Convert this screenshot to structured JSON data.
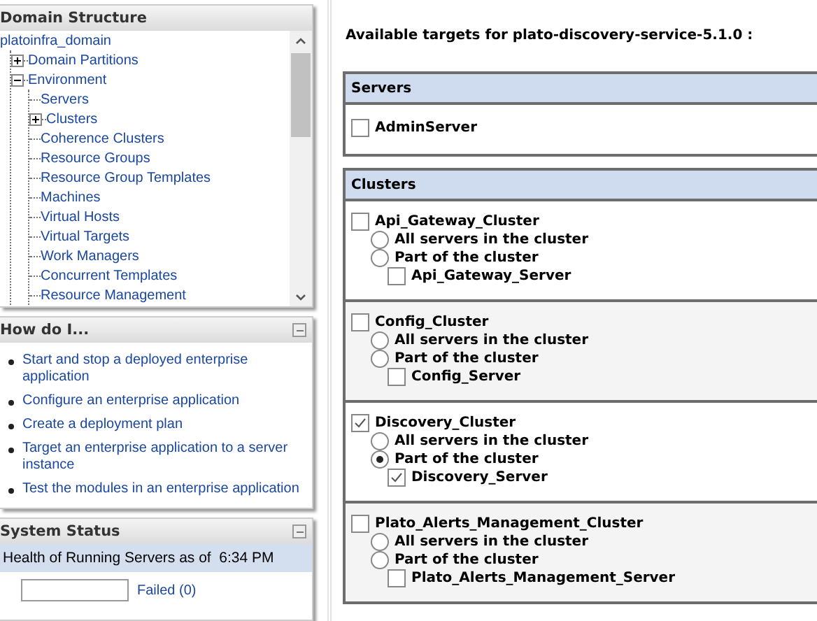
{
  "domain_structure": {
    "title": "Domain Structure",
    "tree": [
      {
        "label": "platoinfra_domain",
        "children": [
          {
            "label": "Domain Partitions",
            "expanded": false
          },
          {
            "label": "Environment",
            "expanded": true,
            "children": [
              {
                "label": "Servers"
              },
              {
                "label": "Clusters",
                "expanded": false
              },
              {
                "label": "Coherence Clusters"
              },
              {
                "label": "Resource Groups"
              },
              {
                "label": "Resource Group Templates"
              },
              {
                "label": "Machines"
              },
              {
                "label": "Virtual Hosts"
              },
              {
                "label": "Virtual Targets"
              },
              {
                "label": "Work Managers"
              },
              {
                "label": "Concurrent Templates"
              },
              {
                "label": "Resource Management"
              }
            ]
          }
        ]
      }
    ]
  },
  "how_do_i": {
    "title": "How do I...",
    "links": [
      "Start and stop a deployed enterprise application",
      "Configure an enterprise application",
      "Create a deployment plan",
      "Target an enterprise application to a server instance",
      "Test the modules in an enterprise application"
    ]
  },
  "system_status": {
    "title": "System Status",
    "health_label": "Health of Running Servers as of  6:34 PM",
    "legend": [
      "Failed (0)"
    ]
  },
  "heading": "Available targets for plato-discovery-service-5.1.0 :",
  "servers": {
    "title": "Servers",
    "items": [
      {
        "label": "AdminServer",
        "checked": false
      }
    ]
  },
  "clusters": {
    "title": "Clusters",
    "items": [
      {
        "name": "Api_Gateway_Cluster",
        "checked": false,
        "options": [
          {
            "label": "All servers in the cluster",
            "selected": false
          },
          {
            "label": "Part of the cluster",
            "selected": false
          }
        ],
        "servers": [
          {
            "label": "Api_Gateway_Server",
            "checked": false
          }
        ]
      },
      {
        "name": "Config_Cluster",
        "checked": false,
        "options": [
          {
            "label": "All servers in the cluster",
            "selected": false
          },
          {
            "label": "Part of the cluster",
            "selected": false
          }
        ],
        "servers": [
          {
            "label": "Config_Server",
            "checked": false
          }
        ]
      },
      {
        "name": "Discovery_Cluster",
        "checked": true,
        "options": [
          {
            "label": "All servers in the cluster",
            "selected": false
          },
          {
            "label": "Part of the cluster",
            "selected": true
          }
        ],
        "servers": [
          {
            "label": "Discovery_Server",
            "checked": true
          }
        ]
      },
      {
        "name": "Plato_Alerts_Management_Cluster",
        "checked": false,
        "options": [
          {
            "label": "All servers in the cluster",
            "selected": false
          },
          {
            "label": "Part of the cluster",
            "selected": false
          }
        ],
        "servers": [
          {
            "label": "Plato_Alerts_Management_Server",
            "checked": false
          }
        ]
      }
    ]
  }
}
